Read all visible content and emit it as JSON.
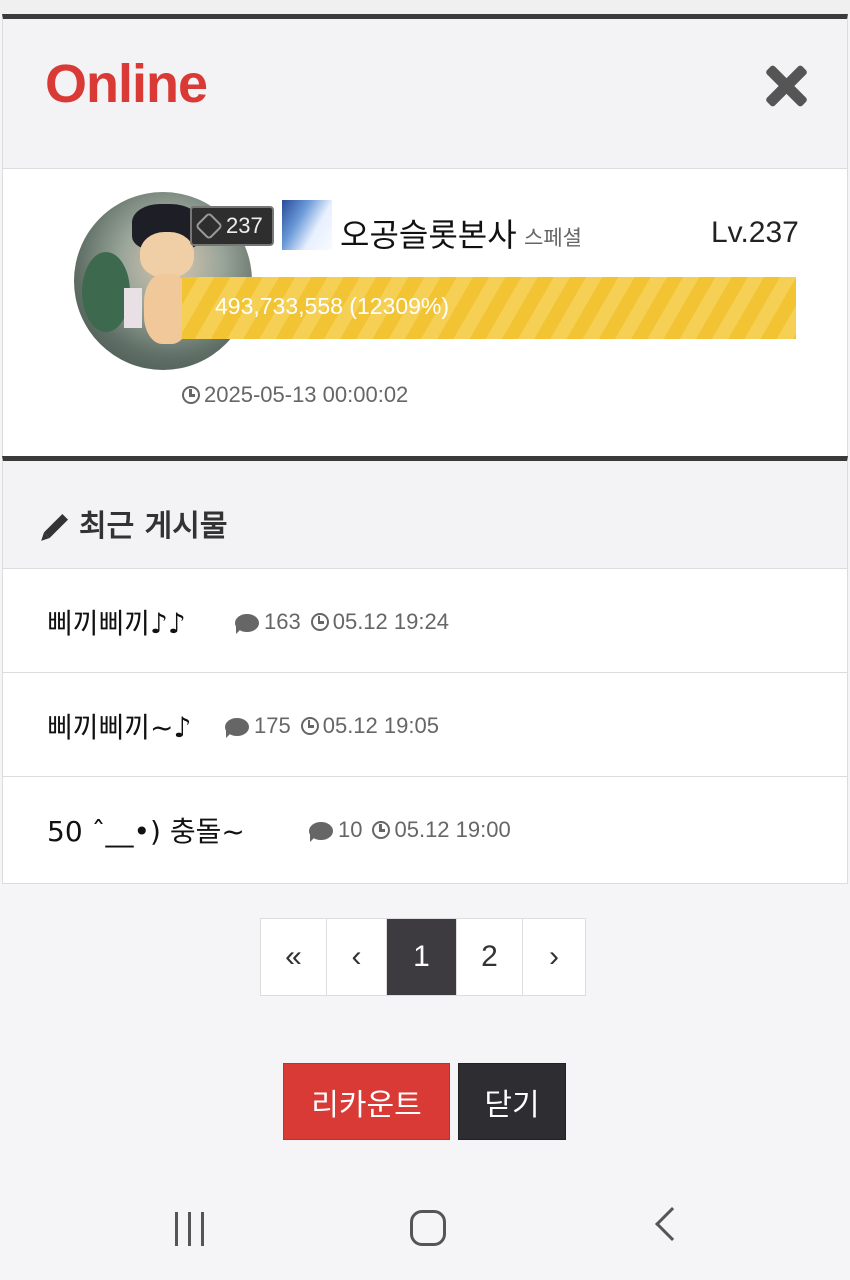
{
  "header": {
    "title": "Online",
    "close_icon": "close-icon"
  },
  "profile": {
    "badge_level": "237",
    "nickname": "오공슬롯본사",
    "rank": "스페셜",
    "level": "Lv.237",
    "xp_text": "493,733,558 (12309%)",
    "xp_fill_fraction": 1.0,
    "joined": "2025-05-13 00:00:02"
  },
  "recent_posts": {
    "title": "최근 게시물",
    "items": [
      {
        "title": "삐끼삐끼♪♪",
        "comments": "163",
        "time": "05.12 19:24"
      },
      {
        "title": "삐끼삐끼~♪",
        "comments": "175",
        "time": "05.12 19:05"
      },
      {
        "title": "50 ˆ__•) 충돌~",
        "comments": "10",
        "time": "05.12 19:00"
      }
    ]
  },
  "pagination": {
    "first": "«",
    "prev": "‹",
    "pages": [
      "1",
      "2"
    ],
    "current": "1",
    "next": "›"
  },
  "buttons": {
    "recount": "리카운트",
    "close": "닫기"
  },
  "colors": {
    "accent": "#d93a35",
    "xp_bar": "#f2c333",
    "dark": "#3d3b3f"
  }
}
